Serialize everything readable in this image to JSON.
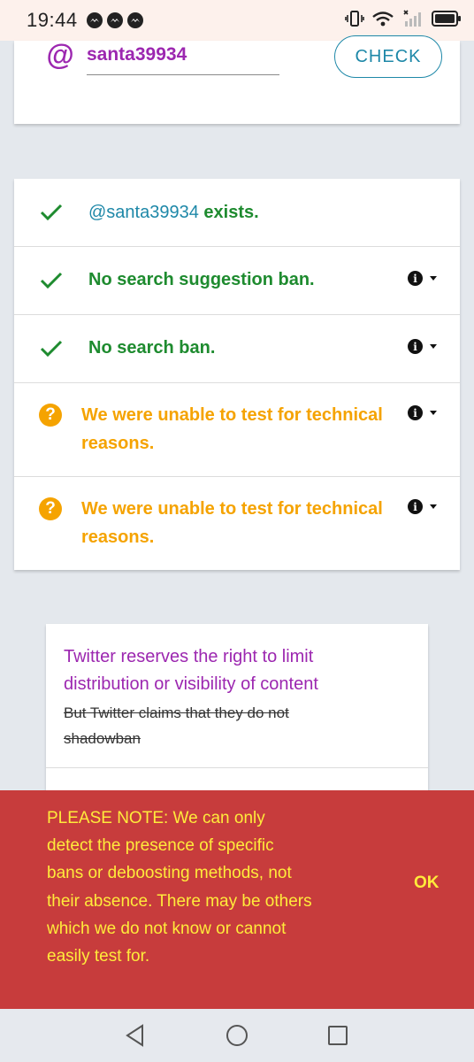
{
  "status_bar": {
    "time": "19:44",
    "notification_icons": [
      "messenger-icon",
      "messenger-icon",
      "messenger-icon"
    ],
    "system_icons": [
      "vibrate-icon",
      "wifi-icon",
      "signal-icon",
      "battery-icon"
    ]
  },
  "search": {
    "at_symbol": "@",
    "username_value": "santa39934",
    "check_label": "CHECK"
  },
  "results": [
    {
      "status": "ok",
      "icon": "checkmark-icon",
      "handle": "@santa39934",
      "text": " exists.",
      "has_info": false
    },
    {
      "status": "ok",
      "icon": "checkmark-icon",
      "text": "No search suggestion ban.",
      "has_info": true
    },
    {
      "status": "ok",
      "icon": "checkmark-icon",
      "text": "No search ban.",
      "has_info": true
    },
    {
      "status": "unknown",
      "icon": "question-icon",
      "text": "We were unable to test for technical reasons.",
      "has_info": true
    },
    {
      "status": "unknown",
      "icon": "question-icon",
      "text": "We were unable to test for technical reasons.",
      "has_info": true
    }
  ],
  "info_card": {
    "highlight": "Twitter reserves the right to limit distribution or visibility of content",
    "strikethrough": "But Twitter claims that they do not shadowban"
  },
  "snackbar": {
    "message": "PLEASE NOTE: We can only detect the presence of specific bans or deboosting methods, not their absence. There may be others which we do not know or cannot easily test for.",
    "action": "OK"
  },
  "colors": {
    "accent_purple": "#9c27b0",
    "link_blue": "#1e88a8",
    "success_green": "#1e8b2f",
    "warning_orange": "#f5a300",
    "snackbar_red": "#c73c3c",
    "snackbar_text": "#ffeb3b"
  },
  "nav": [
    "back-icon",
    "home-icon",
    "recents-icon"
  ]
}
